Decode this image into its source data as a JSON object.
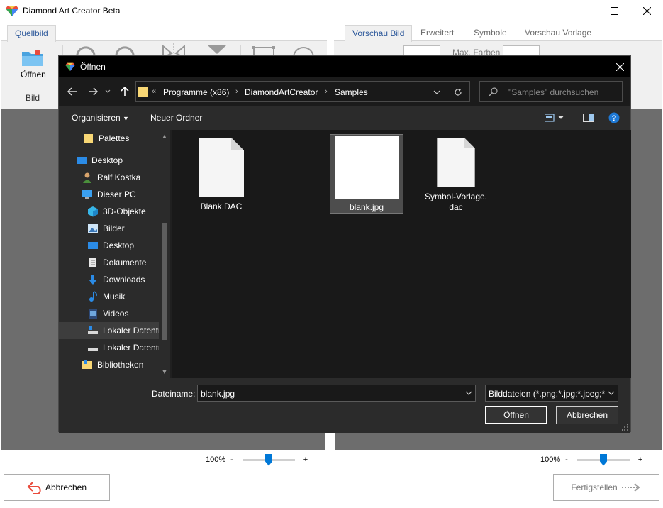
{
  "window": {
    "title": "Diamond Art Creator Beta"
  },
  "ribbon_left": {
    "tabs": [
      {
        "label": "Quellbild"
      }
    ],
    "open_button_label": "Öffnen",
    "group_label": "Bild"
  },
  "ribbon_right": {
    "tabs": [
      {
        "label": "Vorschau Bild"
      },
      {
        "label": "Erweitert"
      },
      {
        "label": "Symbole"
      },
      {
        "label": "Vorschau Vorlage"
      }
    ],
    "max_colors_label": "Max. Farben"
  },
  "zoom_left": {
    "percent": "100%",
    "minus": "-",
    "plus": "+",
    "level": 0.5
  },
  "zoom_right": {
    "percent": "100%",
    "minus": "-",
    "plus": "+",
    "level": 0.5
  },
  "bottom": {
    "cancel_label": "Abbrechen",
    "finish_label": "Fertigstellen"
  },
  "dialog": {
    "title": "Öffnen",
    "address": {
      "overflow": "«",
      "crumbs": [
        "Programme (x86)",
        "DiamondArtCreator",
        "Samples"
      ]
    },
    "search_placeholder": "\"Samples\" durchsuchen",
    "commands": {
      "organize": "Organisieren",
      "new_folder": "Neuer Ordner"
    },
    "nav_items": [
      {
        "label": "Palettes",
        "icon": "folder-icon"
      },
      {
        "label": "Desktop",
        "icon": "desktop-icon"
      },
      {
        "label": "Ralf Kostka",
        "icon": "user-icon"
      },
      {
        "label": "Dieser PC",
        "icon": "pc-icon"
      },
      {
        "label": "3D-Objekte",
        "icon": "cube-icon"
      },
      {
        "label": "Bilder",
        "icon": "pictures-icon"
      },
      {
        "label": "Desktop",
        "icon": "desktop-icon"
      },
      {
        "label": "Dokumente",
        "icon": "documents-icon"
      },
      {
        "label": "Downloads",
        "icon": "download-icon"
      },
      {
        "label": "Musik",
        "icon": "music-icon"
      },
      {
        "label": "Videos",
        "icon": "video-icon"
      },
      {
        "label": "Lokaler Datentr",
        "icon": "drive-icon"
      },
      {
        "label": "Lokaler Datentr",
        "icon": "drive-icon"
      },
      {
        "label": "Bibliotheken",
        "icon": "library-icon"
      }
    ],
    "files": [
      {
        "name": "Blank.DAC"
      },
      {
        "name": "blank.jpg"
      },
      {
        "name": "Symbol-Vorlage.",
        "name2": "dac"
      }
    ],
    "filename_label": "Dateiname:",
    "filename_value": "blank.jpg",
    "filetype_value": "Bilddateien (*.png;*.jpg;*.jpeg;*",
    "open_label": "Öffnen",
    "cancel_label": "Abbrechen"
  }
}
